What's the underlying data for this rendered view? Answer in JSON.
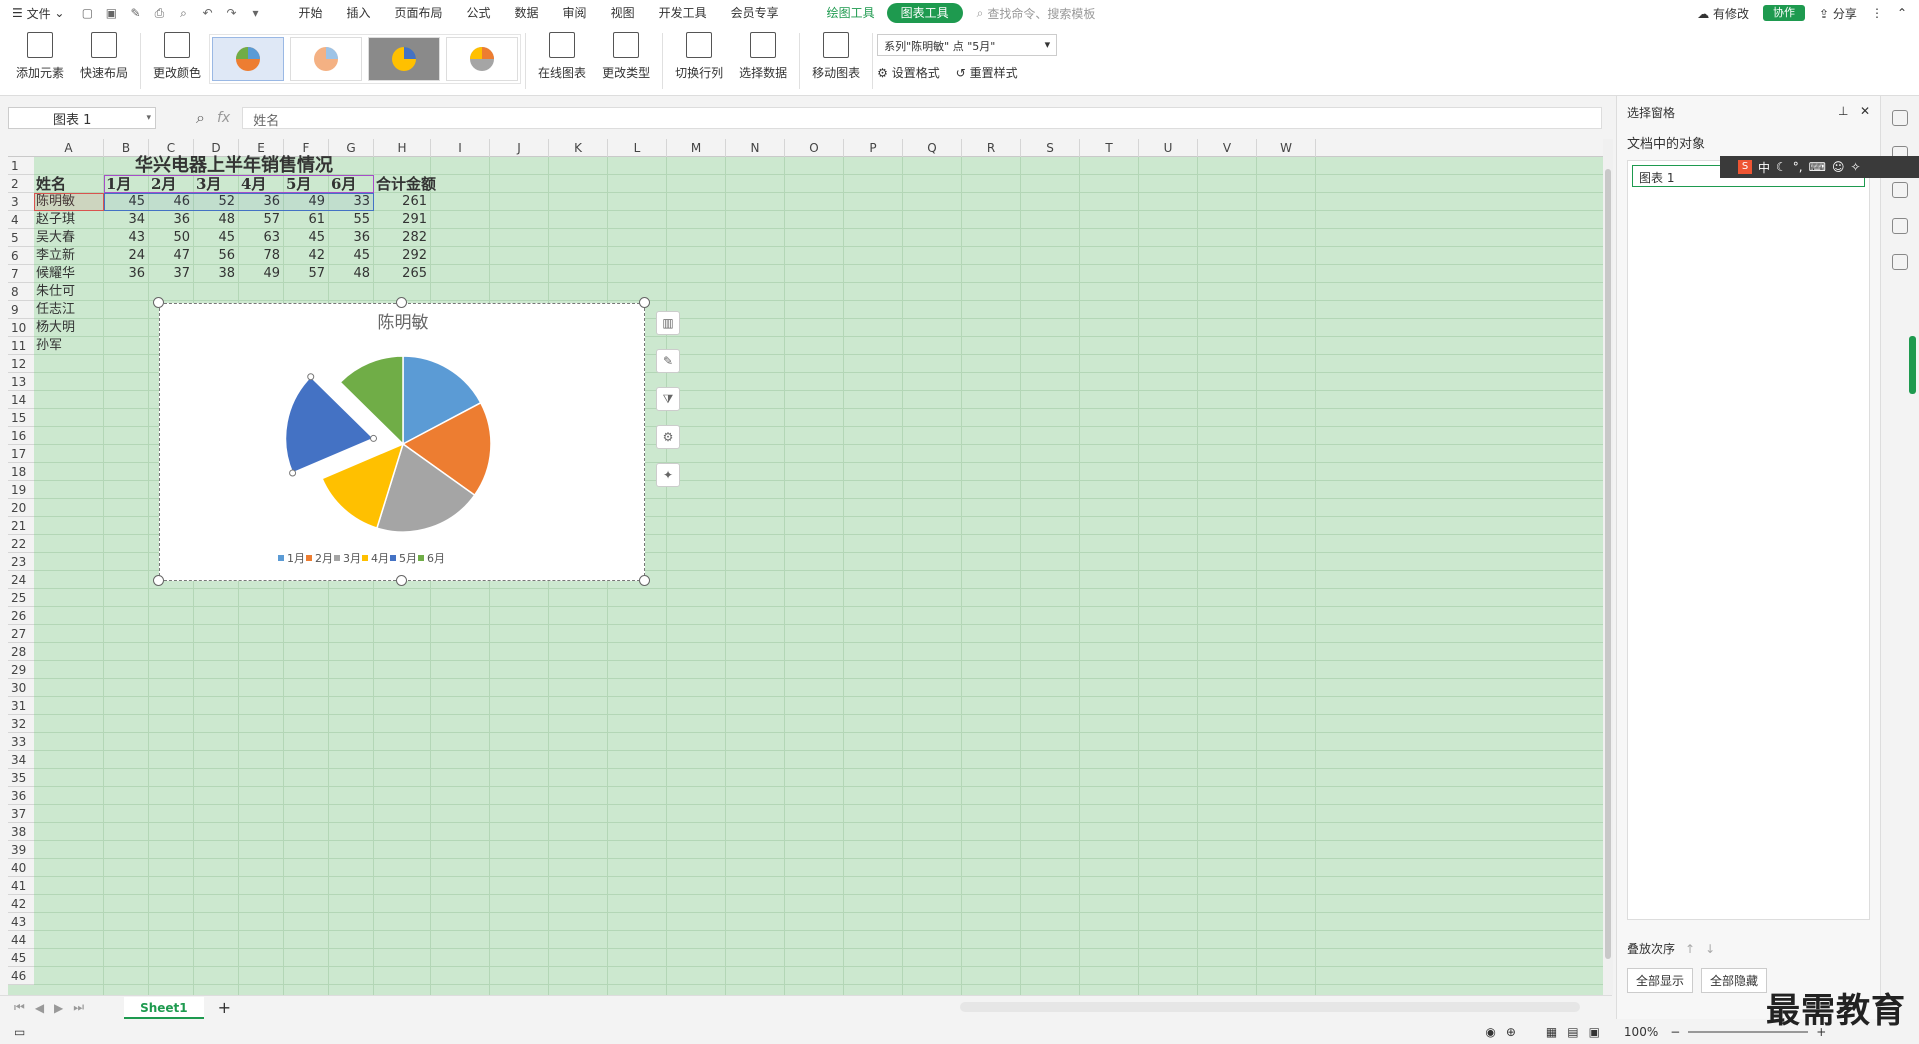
{
  "topbar": {
    "file_label": "文件",
    "menus": [
      "开始",
      "插入",
      "页面布局",
      "公式",
      "数据",
      "审阅",
      "视图",
      "开发工具",
      "会员专享"
    ],
    "drawing_tool": "绘图工具",
    "chart_tool": "图表工具",
    "search_placeholder": "查找命令、搜索模板",
    "unsynced": "有修改",
    "collab": "协作",
    "share": "分享"
  },
  "ribbon": {
    "add_element": "添加元素",
    "quick_layout": "快速布局",
    "change_color": "更改颜色",
    "online_chart": "在线图表",
    "change_type": "更改类型",
    "switch_rowcol": "切换行列",
    "select_data": "选择数据",
    "move_chart": "移动图表",
    "series_selector": "系列\"陈明敏\" 点 \"5月\"",
    "set_format": "设置格式",
    "reset_style": "重置样式"
  },
  "formula": {
    "namebox": "图表 1",
    "fx": "fx",
    "content": "姓名"
  },
  "columns": [
    "A",
    "B",
    "C",
    "D",
    "E",
    "F",
    "G",
    "H",
    "I",
    "J",
    "K",
    "L",
    "M",
    "N",
    "O",
    "P",
    "Q",
    "R",
    "S",
    "T",
    "U",
    "V",
    "W"
  ],
  "sheet": {
    "title": "华兴电器上半年销售情况",
    "headers": [
      "姓名",
      "1月",
      "2月",
      "3月",
      "4月",
      "5月",
      "6月",
      "合计金额"
    ],
    "rows": [
      [
        "陈明敏",
        "45",
        "46",
        "52",
        "36",
        "49",
        "33",
        "261"
      ],
      [
        "赵子琪",
        "34",
        "36",
        "48",
        "57",
        "61",
        "55",
        "291"
      ],
      [
        "吴大春",
        "43",
        "50",
        "45",
        "63",
        "45",
        "36",
        "282"
      ],
      [
        "李立新",
        "24",
        "47",
        "56",
        "78",
        "42",
        "45",
        "292"
      ],
      [
        "候耀华",
        "36",
        "37",
        "38",
        "49",
        "57",
        "48",
        "265"
      ],
      [
        "朱仕可",
        "",
        "",
        "",
        "",
        "",
        "",
        ""
      ],
      [
        "任志江",
        "",
        "",
        "",
        "",
        "",
        "",
        ""
      ],
      [
        "杨大明",
        "",
        "",
        "",
        "",
        "",
        "",
        ""
      ],
      [
        "孙军",
        "",
        "",
        "",
        "",
        "",
        "",
        ""
      ]
    ]
  },
  "chart_data": {
    "type": "pie",
    "title": "陈明敏",
    "categories": [
      "1月",
      "2月",
      "3月",
      "4月",
      "5月",
      "6月"
    ],
    "values": [
      45,
      46,
      52,
      36,
      49,
      33
    ],
    "colors": [
      "#5b9bd5",
      "#ed7d31",
      "#a5a5a5",
      "#ffc000",
      "#4472c4",
      "#70ad47"
    ],
    "exploded_index": 4,
    "legend_position": "bottom"
  },
  "sheet_tab": "Sheet1",
  "status": {
    "zoom": "100%"
  },
  "pane": {
    "title": "选择窗格",
    "objects_label": "文档中的对象",
    "item": "图表 1",
    "order_label": "叠放次序",
    "show_all": "全部显示",
    "hide_all": "全部隐藏"
  },
  "ime": {
    "lang": "中"
  },
  "watermark": "最需教育"
}
